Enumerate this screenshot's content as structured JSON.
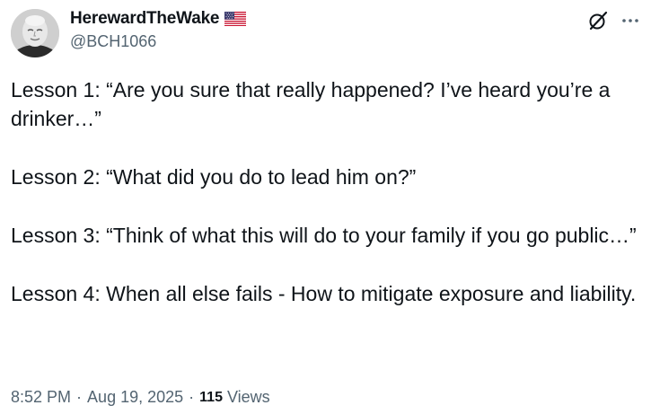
{
  "author": {
    "display_name": "HerewardTheWake",
    "handle": "@BCH1066",
    "flag_icon": "us-flag-icon",
    "avatar_icon": "avatar"
  },
  "actions": {
    "grok_icon": "grok-icon",
    "more_icon": "more-icon"
  },
  "tweet": {
    "paragraphs": [
      "Lesson 1:  “Are you sure that really happened?  I’ve heard you’re a drinker…”",
      "Lesson 2:  “What did you do to lead him on?”",
      "Lesson 3:  “Think of what this will do to your family if you go public…”",
      "Lesson 4:  When all else fails - How to mitigate exposure and liability."
    ]
  },
  "meta": {
    "time": "8:52 PM",
    "separator": "·",
    "date": "Aug 19, 2025",
    "views_count": "115",
    "views_label": "Views"
  },
  "colors": {
    "text": "#0f1419",
    "secondary": "#536471"
  }
}
